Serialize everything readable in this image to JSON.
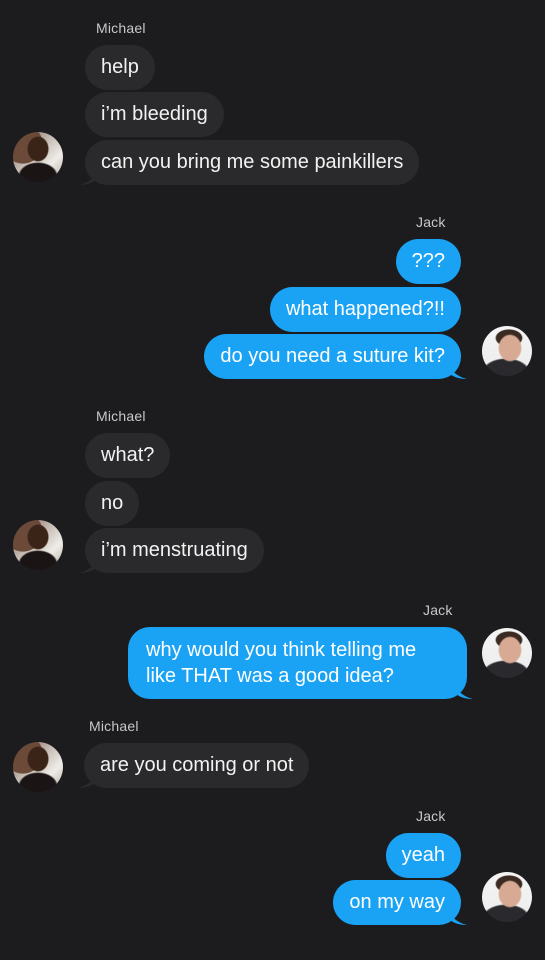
{
  "conversation": {
    "groups": [
      {
        "sender": "Michael",
        "side": "in",
        "messages": [
          "help",
          "i’m bleeding",
          "can you bring me some painkillers"
        ]
      },
      {
        "sender": "Jack",
        "side": "out",
        "messages": [
          "???",
          "what happened?!!",
          "do you need a suture kit?"
        ]
      },
      {
        "sender": "Michael",
        "side": "in",
        "messages": [
          "what?",
          "no",
          "i’m menstruating"
        ]
      },
      {
        "sender": "Jack",
        "side": "out",
        "messages": [
          "why would you think telling me like THAT was a good idea?"
        ]
      },
      {
        "sender": "Michael",
        "side": "in",
        "messages": [
          "are you coming or not"
        ]
      },
      {
        "sender": "Jack",
        "side": "out",
        "messages": [
          "yeah",
          "on my way"
        ]
      }
    ]
  },
  "colors": {
    "background": "#1c1c1e",
    "incoming_bubble": "#2a2a2c",
    "outgoing_bubble": "#1aa3f5"
  },
  "icons": {
    "michael_avatar": "avatar-michael-icon",
    "jack_avatar": "avatar-jack-icon"
  }
}
